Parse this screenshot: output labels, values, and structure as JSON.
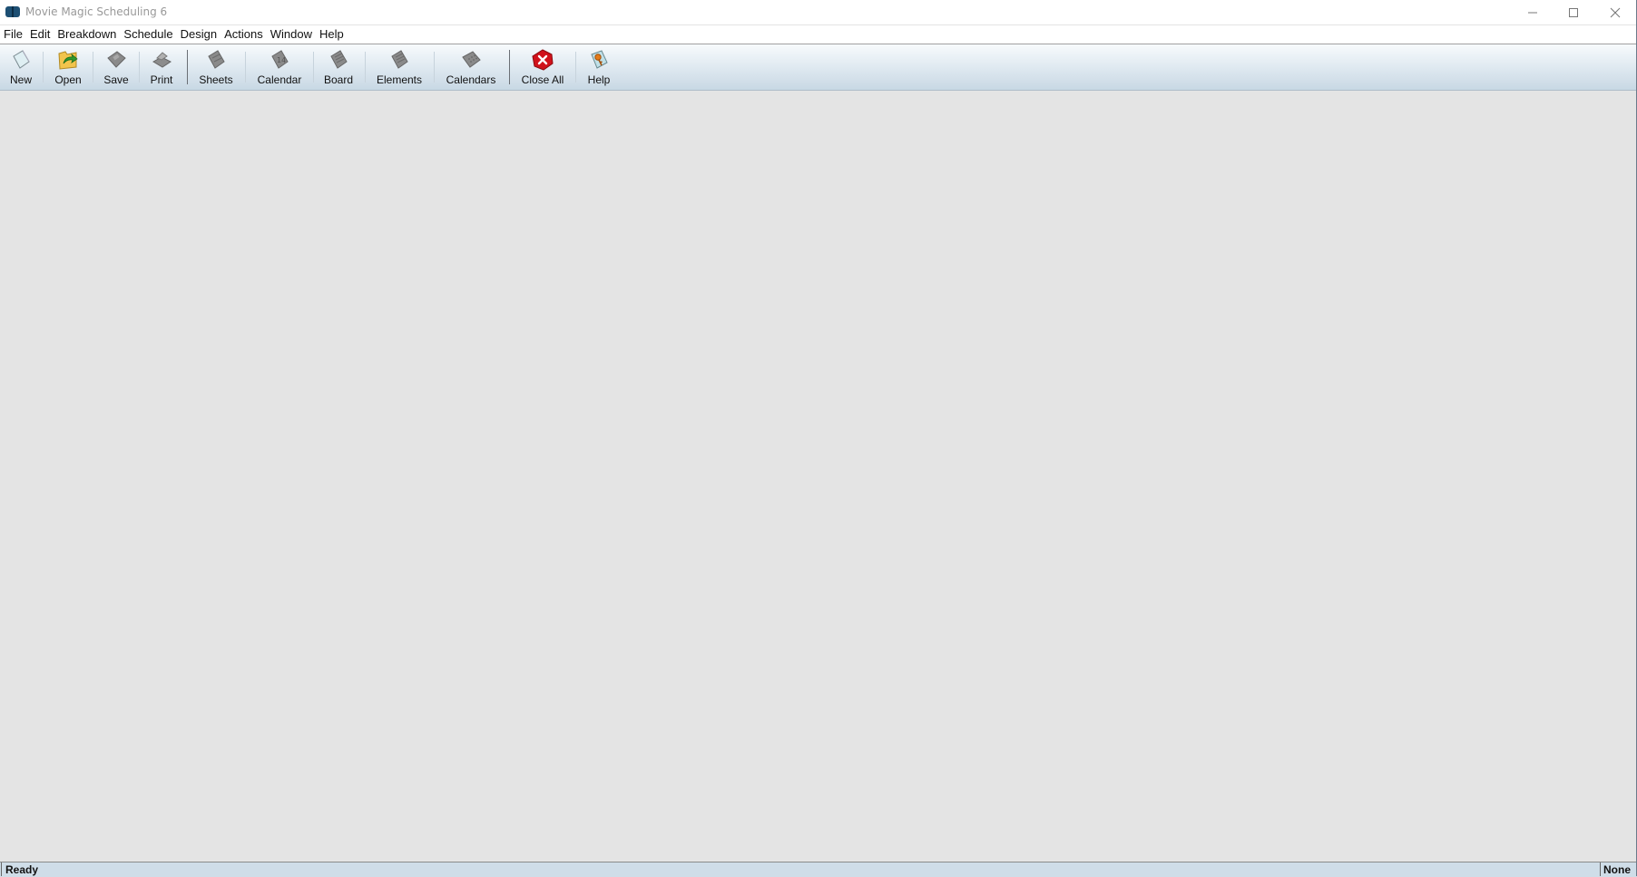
{
  "window": {
    "title": "Movie Magic Scheduling 6",
    "controls": [
      "minimize",
      "maximize",
      "close"
    ]
  },
  "menubar": {
    "items": [
      "File",
      "Edit",
      "Breakdown",
      "Schedule",
      "Design",
      "Actions",
      "Window",
      "Help"
    ]
  },
  "toolbar": {
    "buttons": [
      {
        "label": "New",
        "icon": "new-document-icon"
      },
      {
        "label": "Open",
        "icon": "open-folder-icon"
      },
      {
        "label": "Save",
        "icon": "save-disk-icon"
      },
      {
        "label": "Print",
        "icon": "printer-icon"
      },
      {
        "label": "Sheets",
        "icon": "sheets-icon"
      },
      {
        "label": "Calendar",
        "icon": "calendar-icon",
        "icon_text": "14"
      },
      {
        "label": "Board",
        "icon": "board-icon"
      },
      {
        "label": "Elements",
        "icon": "elements-icon"
      },
      {
        "label": "Calendars",
        "icon": "calendars-icon"
      },
      {
        "label": "Close All",
        "icon": "close-all-icon"
      },
      {
        "label": "Help",
        "icon": "help-icon"
      }
    ]
  },
  "statusbar": {
    "left": "Ready",
    "right": "None"
  },
  "colors": {
    "workspace": "#e4e4e4",
    "toolbar_top": "#f7fafc",
    "toolbar_bottom": "#c8d8e4",
    "statusbar": "#cfdde8",
    "close_all_red": "#d0121b",
    "open_green": "#2e9a2e"
  }
}
